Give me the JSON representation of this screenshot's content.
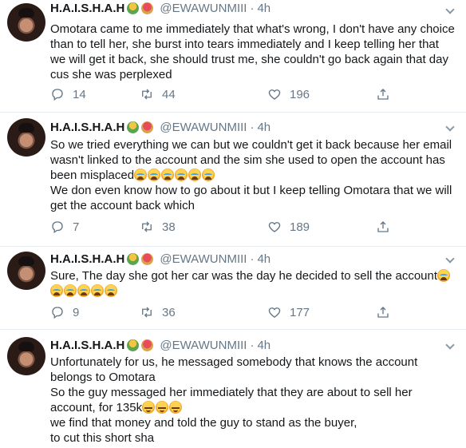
{
  "tweets": [
    {
      "name": "H.A.I.S.H.A.H",
      "handle": "@EWAWUNMIII",
      "sep": "·",
      "time": "4h",
      "lines": [
        "Omotara came to me immediately that what's wrong, I don't have any choice than to tell her, she burst into tears immediately and I keep telling her that we will get it back, she should trust me, she couldn't go back again that day cus she was perplexed"
      ],
      "replies": "14",
      "retweets": "44",
      "likes": "196"
    },
    {
      "name": "H.A.I.S.H.A.H",
      "handle": "@EWAWUNMIII",
      "sep": "·",
      "time": "4h",
      "lines": [
        "So we tried everything we can but we couldn't get it back because her email wasn't linked to the account and the sim she used to open the account has been misplaced",
        "We don even know how to go about it but I keep telling Omotara that we will get the account back which"
      ],
      "replies": "7",
      "retweets": "38",
      "likes": "189"
    },
    {
      "name": "H.A.I.S.H.A.H",
      "handle": "@EWAWUNMIII",
      "sep": "·",
      "time": "4h",
      "lines": [
        "Sure, The day she got her car was the day he decided to sell the account"
      ],
      "replies": "9",
      "retweets": "36",
      "likes": "177"
    },
    {
      "name": "H.A.I.S.H.A.H",
      "handle": "@EWAWUNMIII",
      "sep": "·",
      "time": "4h",
      "lines": [
        "Unfortunately for us, he messaged somebody that knows the account belongs to Omotara",
        "So the guy messaged her immediately that they are about to sell her account, for 135k",
        "we find that money and told the guy to stand as the buyer,",
        "to cut this short sha"
      ]
    }
  ],
  "icons": {
    "reply": "reply-icon",
    "retweet": "retweet-icon",
    "like": "heart-icon",
    "share": "share-icon",
    "menu": "chevron-down-icon"
  },
  "colors": {
    "muted": "#657786",
    "text": "#14171a",
    "divider": "#e6ecf0"
  }
}
